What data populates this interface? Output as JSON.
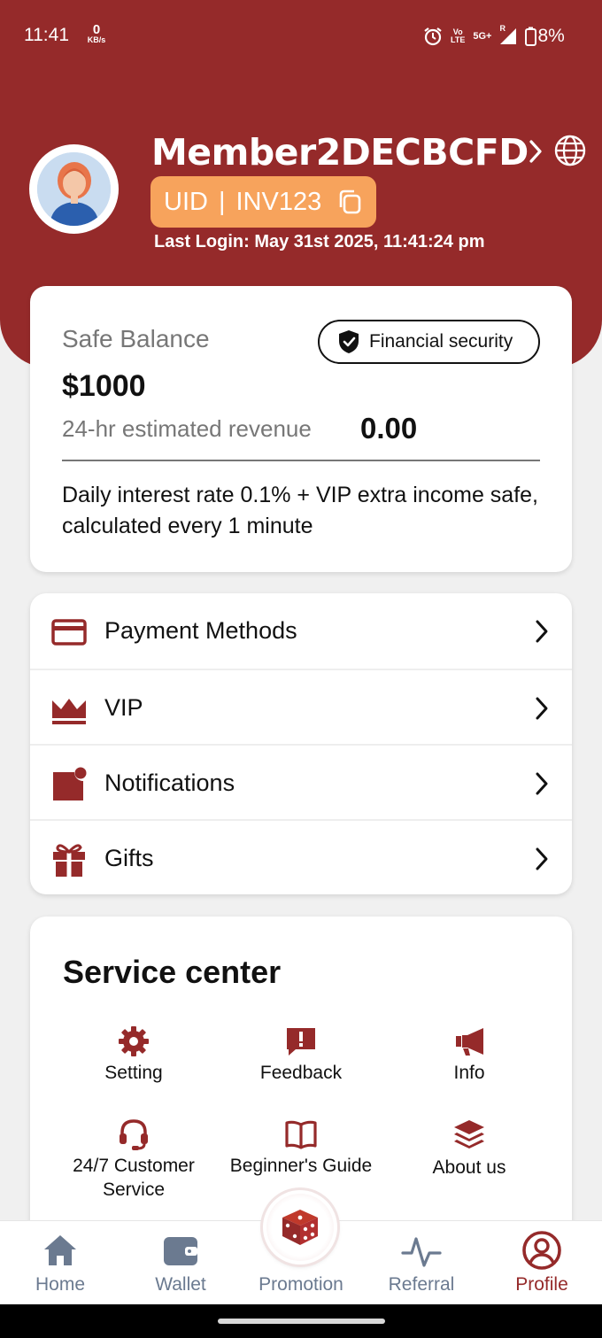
{
  "status_bar": {
    "time": "11:41",
    "speed_value": "0",
    "speed_unit": "KB/s",
    "volte_top": "Vo",
    "volte_bottom": "LTE",
    "network": "5G+",
    "roaming": "R",
    "battery": "8%"
  },
  "profile": {
    "username": "Member2DECBCFD",
    "uid_label": "UID",
    "uid_separator": "|",
    "uid_value": "INV123",
    "last_login": "Last Login: May 31st 2025, 11:41:24 pm"
  },
  "balance": {
    "label": "Safe Balance",
    "security_badge": "Financial security",
    "amount": "$1000",
    "revenue_label": "24-hr estimated revenue",
    "revenue_value": "0.00",
    "interest_note": "Daily interest rate 0.1% + VIP extra income safe, calculated every 1 minute"
  },
  "menu": {
    "items": [
      {
        "label": "Payment Methods",
        "icon": "card-icon"
      },
      {
        "label": "VIP",
        "icon": "crown-icon"
      },
      {
        "label": "Notifications",
        "icon": "notification-icon"
      },
      {
        "label": "Gifts",
        "icon": "gift-icon"
      }
    ]
  },
  "service_center": {
    "title": "Service center",
    "items": [
      {
        "label": "Setting",
        "icon": "gear-icon"
      },
      {
        "label": "Feedback",
        "icon": "feedback-icon"
      },
      {
        "label": "Info",
        "icon": "megaphone-icon"
      },
      {
        "label": "24/7 Customer Service",
        "icon": "headset-icon"
      },
      {
        "label": "Beginner's Guide",
        "icon": "book-icon"
      },
      {
        "label": "About us",
        "icon": "layers-icon"
      }
    ]
  },
  "bottom_nav": {
    "items": [
      {
        "label": "Home",
        "icon": "home-icon"
      },
      {
        "label": "Wallet",
        "icon": "wallet-icon"
      },
      {
        "label": "Promotion",
        "icon": "dice-icon"
      },
      {
        "label": "Referral",
        "icon": "activity-icon"
      },
      {
        "label": "Profile",
        "icon": "user-circle-icon"
      }
    ],
    "active": "Profile"
  },
  "colors": {
    "brand": "#952a2a",
    "uid_badge": "#f7a35c",
    "nav_inactive": "#6b7a90"
  }
}
